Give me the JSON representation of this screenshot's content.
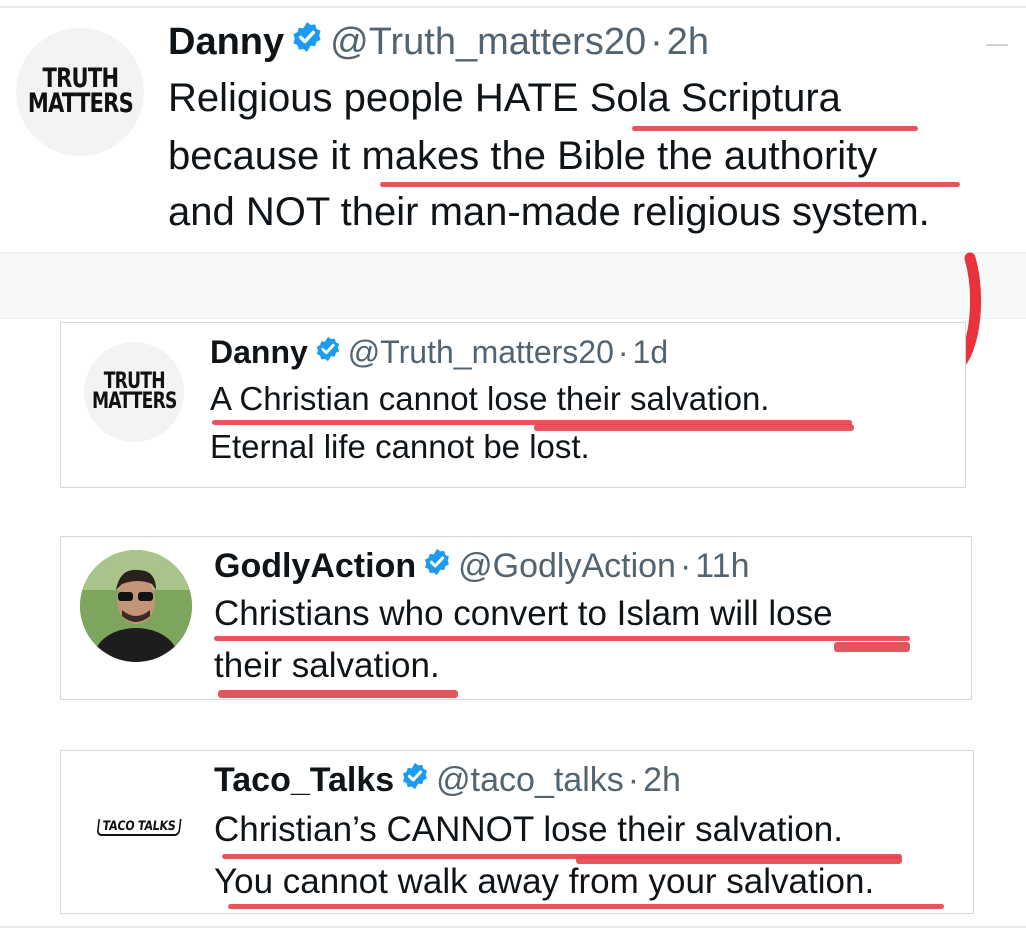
{
  "colors": {
    "verified": "#1d9bf0",
    "underline": "#e5454f",
    "arrow": "#e8323c",
    "handle": "#536471"
  },
  "top_tweet": {
    "logo_text_line1": "TRUTH",
    "logo_text_line2": "MATTERS",
    "name": "Danny",
    "handle": "@Truth_matters20",
    "separator": "·",
    "time": "2h",
    "lines": [
      "Religious people HATE Sola Scriptura",
      "because it makes the Bible the authority",
      "and NOT their man-made religious system."
    ]
  },
  "annotation": {
    "arrow": "red-curved-arrow-icon"
  },
  "quoted_tweets": [
    {
      "avatar": "truth-matters-logo",
      "logo_text_line1": "TRUTH",
      "logo_text_line2": "MATTERS",
      "name": "Danny",
      "handle": "@Truth_matters20",
      "separator": "·",
      "time": "1d",
      "lines": [
        "A Christian cannot lose their salvation.",
        "Eternal life cannot be lost."
      ]
    },
    {
      "avatar": "profile-photo",
      "name": "GodlyAction",
      "handle": "@GodlyAction",
      "separator": "·",
      "time": "11h",
      "lines": [
        "Christians who convert to Islam will lose",
        "their salvation."
      ]
    },
    {
      "avatar": "taco-talks-logo",
      "logo_text": "TACO TALKS",
      "name": "Taco_Talks",
      "handle": "@taco_talks",
      "separator": "·",
      "time": "2h",
      "lines": [
        "Christian’s CANNOT lose their salvation.",
        "You cannot walk away from your salvation."
      ]
    }
  ]
}
